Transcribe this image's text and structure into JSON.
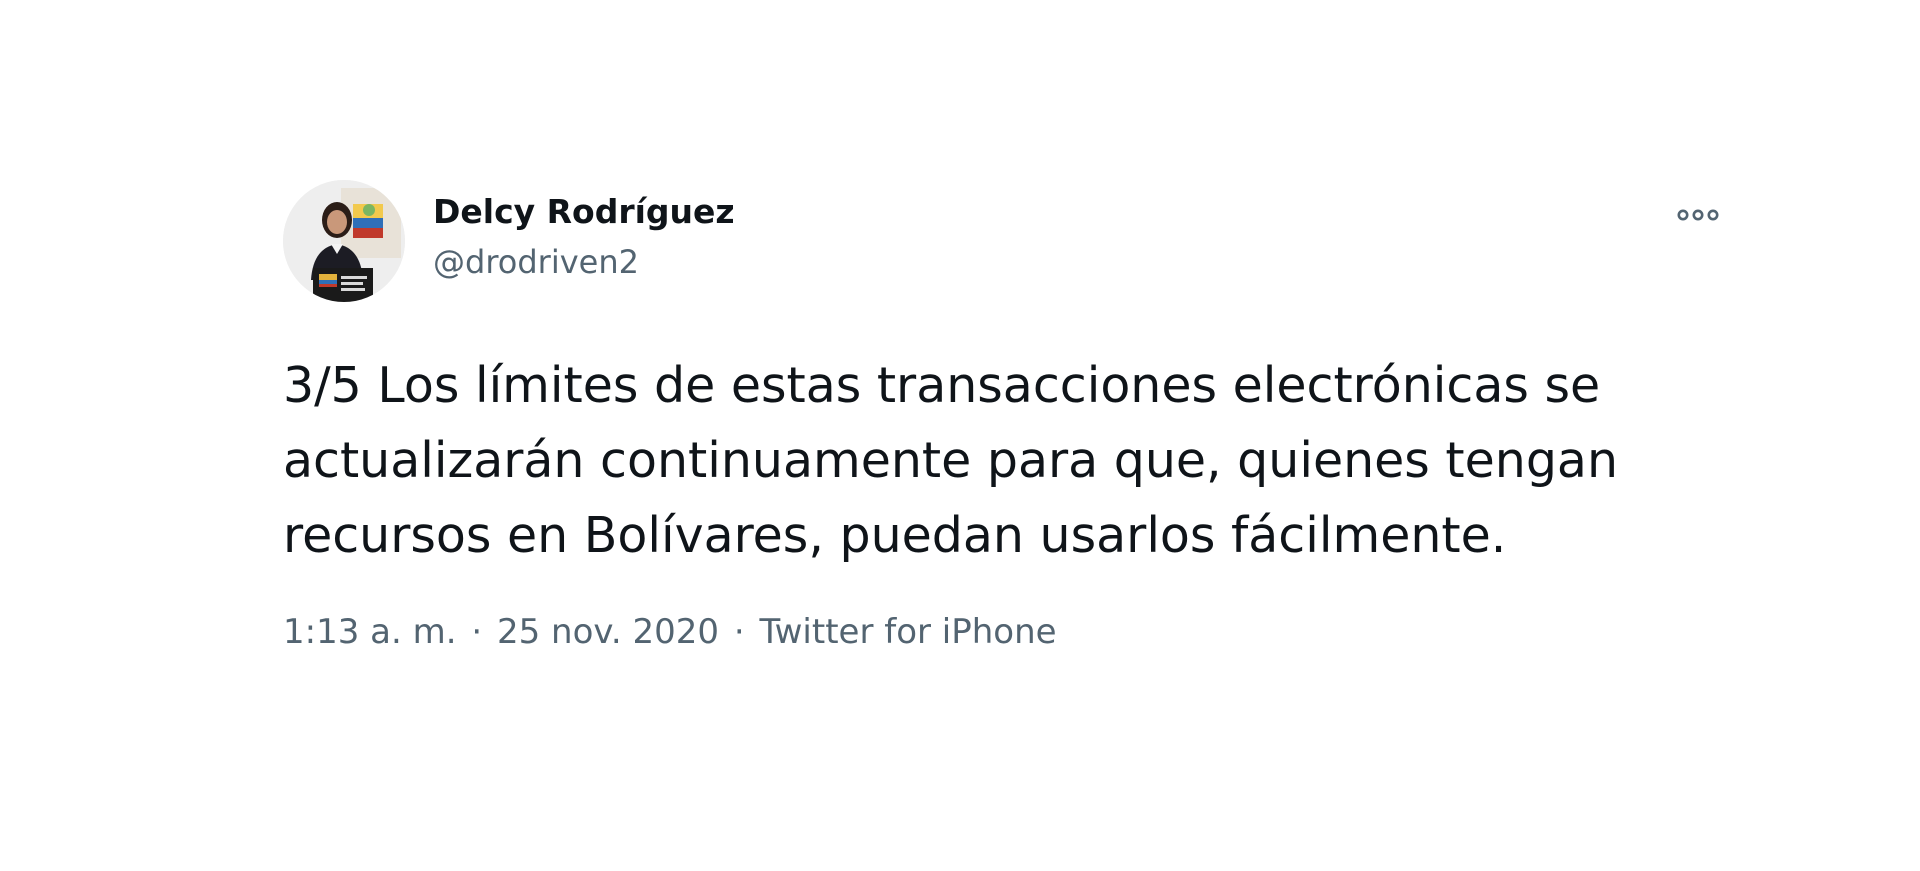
{
  "author": {
    "name": "Delcy Rodríguez",
    "handle": "@drodriven2"
  },
  "tweet": {
    "text_lines": [
      "3/5 Los límites de estas transacciones electrónicas se",
      "actualizarán continuamente para que, quienes tengan",
      "recursos en Bolívares, puedan usarlos fácilmente."
    ]
  },
  "meta": {
    "time": "1:13 a. m.",
    "separator": "·",
    "date": "25 nov. 2020",
    "source": "Twitter for iPhone"
  },
  "icons": {
    "more": "more-options-icon"
  },
  "colors": {
    "text": "#0f1419",
    "secondary": "#536471",
    "background": "#ffffff"
  }
}
